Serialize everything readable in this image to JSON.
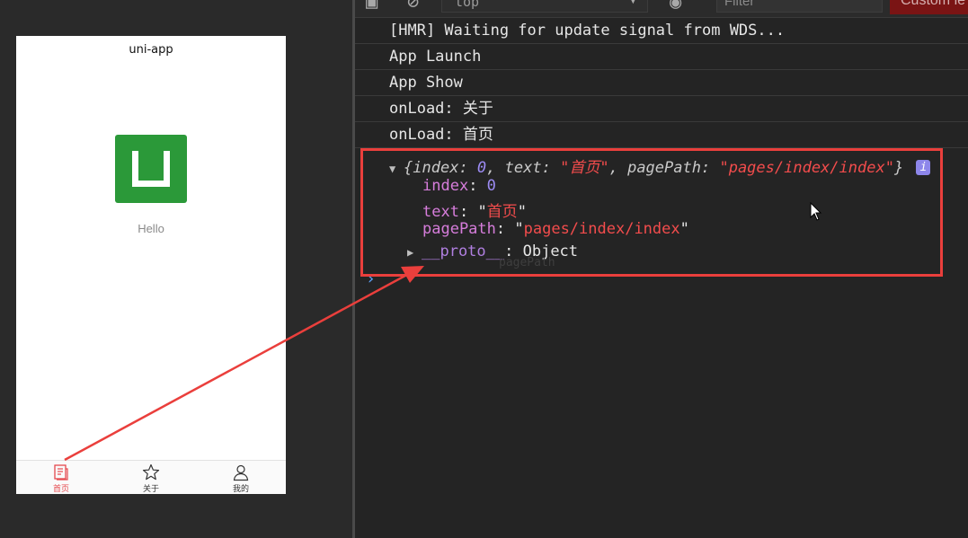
{
  "simulator": {
    "nav_title": "uni-app",
    "hello_text": "Hello",
    "tabs": [
      {
        "label": "首页",
        "icon": "document-icon",
        "active": true
      },
      {
        "label": "关于",
        "icon": "star-icon",
        "active": false
      },
      {
        "label": "我的",
        "icon": "person-icon",
        "active": false
      }
    ],
    "logo_color": "#2b9939"
  },
  "console": {
    "toolbar": {
      "context": "top",
      "filter_placeholder": "Filter",
      "custom_button": "Custom le"
    },
    "logs": [
      "[HMR] Waiting for update signal from WDS...",
      "App Launch",
      "App Show",
      "onLoad: 关于",
      "onLoad: 首页"
    ],
    "object": {
      "open_brace": "{",
      "close_brace": "}",
      "comma": ", ",
      "colon": ": ",
      "quote": "\"",
      "info_badge": "i",
      "preview": {
        "index_key": "index",
        "index_val": "0",
        "text_key": "text",
        "text_val": "首页",
        "pagePath_key": "pagePath",
        "pagePath_val": "pages/index/index"
      },
      "props": [
        {
          "key": "index",
          "value": "0"
        },
        {
          "key": "text",
          "value": "首页"
        },
        {
          "key": "pagePath",
          "value": "pages/index/index"
        }
      ],
      "proto_key": "__proto__",
      "proto_value": "Object"
    },
    "ghost_text": "pagePath",
    "prompt": "›"
  },
  "colors": {
    "highlight": "#ea3f3c",
    "string": "#f24c4c",
    "number": "#9d8cf5",
    "key": "#d67ddb",
    "active_tab": "#e5484d"
  }
}
